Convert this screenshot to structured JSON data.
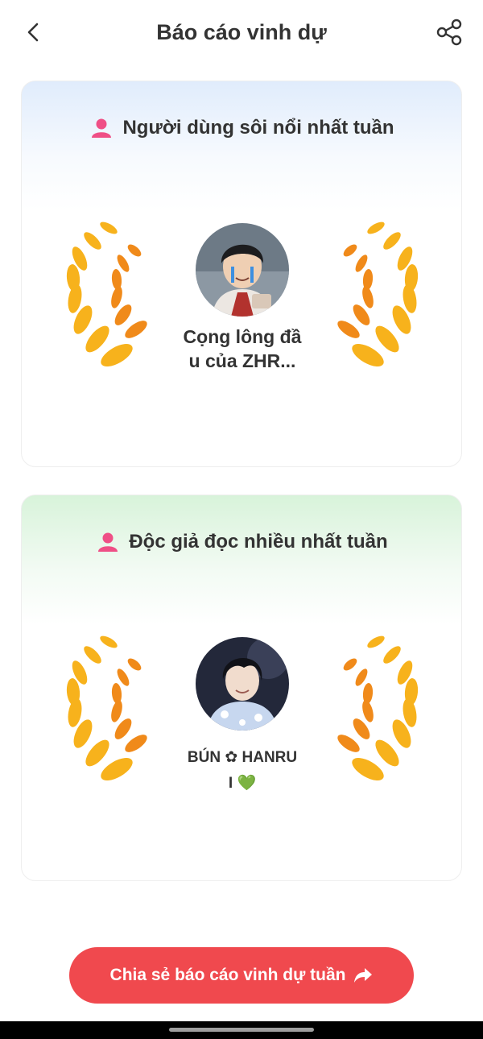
{
  "header": {
    "title": "Báo cáo vinh dự",
    "back_icon": "chevron-left-icon",
    "share_icon": "share-icon"
  },
  "cards": [
    {
      "heading": "Người dùng sôi nổi nhất tuần",
      "icon": "user-icon",
      "user_name_line1": "Cọng lông đầ",
      "user_name_line2": "u của ZHR...",
      "accent": "#e0ecfc"
    },
    {
      "heading": "Độc giả đọc nhiều nhất tuần",
      "icon": "user-icon",
      "user_name_line1": "BÚN ✿ HANRU",
      "user_name_line2": "I 💚",
      "accent": "#d8f3da"
    }
  ],
  "share_button": {
    "label": "Chia sẻ báo cáo vinh dự tuần",
    "icon": "share-arrow-icon",
    "color": "#f0494e"
  },
  "colors": {
    "laurel_gold": "#f7b21c",
    "laurel_orange": "#f08a1a",
    "user_icon_pink": "#ef4f86"
  }
}
